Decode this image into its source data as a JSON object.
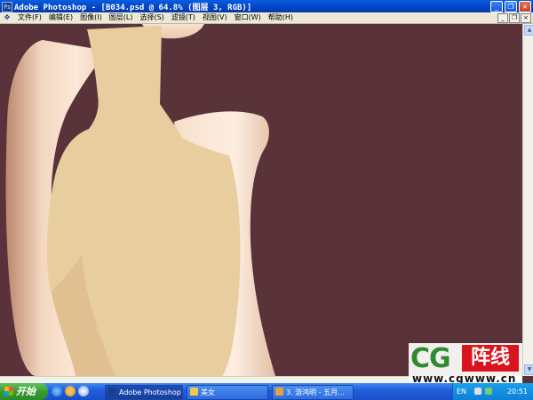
{
  "window": {
    "title": "Adobe Photoshop - [B034.psd @ 64.8% (图层 3, RGB)]",
    "app_icon_label": "Ps"
  },
  "menu": {
    "items": [
      "文件(F)",
      "编辑(E)",
      "图像(I)",
      "图层(L)",
      "选择(S)",
      "滤镜(T)",
      "视图(V)",
      "窗口(W)",
      "帮助(H)"
    ]
  },
  "window_controls": {
    "minimize": "_",
    "restore": "❐",
    "close": "×"
  },
  "doc_controls": {
    "minimize": "_",
    "restore": "❐",
    "close": "×"
  },
  "taskbar": {
    "start_label": "开始",
    "tasks": [
      {
        "label": "Adobe Photoshop ...",
        "active": true
      },
      {
        "label": "美女",
        "active": false
      },
      {
        "label": "3. 游鸿明 - 五月...",
        "active": false
      }
    ],
    "tray": {
      "lang": "EN",
      "clock": "20:51"
    }
  },
  "watermark": {
    "cg_text": "CG",
    "cn_text": "阵线",
    "url_text": "www.cgwww.cn"
  },
  "colors": {
    "canvas_bg": "#5a323a",
    "garment": "#e8cd9f",
    "skin": "#f4dcc4"
  }
}
